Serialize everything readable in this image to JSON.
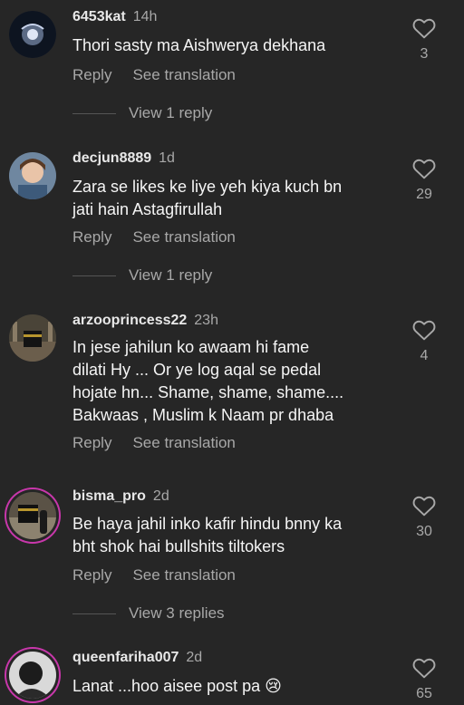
{
  "labels": {
    "reply": "Reply",
    "see_translation": "See translation"
  },
  "comments": [
    {
      "username": "6453kat",
      "time": "14h",
      "lines": [
        "Thori sasty ma Aishwerya dekhana"
      ],
      "likes": "3",
      "replies": "View 1 reply"
    },
    {
      "username": "decjun8889",
      "time": "1d",
      "lines": [
        "Zara se likes ke liye yeh kiya kuch bn",
        "jati hain Astagfirullah"
      ],
      "likes": "29",
      "replies": "View 1 reply"
    },
    {
      "username": "arzooprincess22",
      "time": "23h",
      "lines": [
        "In jese jahilun ko awaam hi fame",
        "dilati Hy ... Or ye log aqal se pedal",
        "hojate hn... Shame, shame, shame....",
        "Bakwaas , Muslim k Naam pr dhaba"
      ],
      "likes": "4",
      "replies": ""
    },
    {
      "username": "bisma_pro",
      "time": "2d",
      "lines": [
        "Be haya jahil inko kafir hindu bnny ka",
        "bht shok hai bullshits tiltokers"
      ],
      "likes": "30",
      "replies": "View 3 replies"
    },
    {
      "username": "queenfariha007",
      "time": "2d",
      "lines": [
        "Lanat ...hoo aisee post pa 😢"
      ],
      "likes": "65",
      "replies": ""
    }
  ],
  "icons": {
    "like": "heart-outline-icon"
  },
  "colors": {
    "background": "#262626",
    "secondary_text": "#a8a8a8",
    "story_ring": "#c837ab"
  }
}
